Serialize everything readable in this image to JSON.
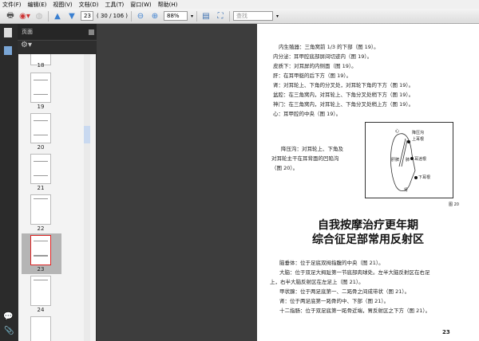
{
  "menu": [
    "文件(F)",
    "编辑(E)",
    "视图(V)",
    "文档(D)",
    "工具(T)",
    "窗口(W)",
    "帮助(H)"
  ],
  "toolbar": {
    "page_value": "23",
    "page_count": "( 30 / 106 )",
    "zoom": "88%",
    "search_placeholder": "查找"
  },
  "panel": {
    "title": "页面"
  },
  "thumbnails": [
    "18",
    "19",
    "20",
    "21",
    "22",
    "23",
    "24"
  ],
  "selected_page": "23",
  "document": {
    "lines": [
      "内生殖器：三角窝前 1/3 的下部（图 19）。",
      "内分泌：耳甲腔底部屏间切迹内（图 19）。",
      "皮质下：对耳屏的内侧面（图 19）。",
      "肝：在耳甲艇的后下方（图 19）。",
      "肾：对耳轮上、下角的分叉处，对耳轮下角的下方（图 19）。",
      "盆腔：在三角窝内，对耳轮上、下角分叉处稍下方（图 19）。",
      "神门：在三角窝内，对耳轮上、下角分叉处稍上方（图 19）。",
      "心：耳甲腔的中央（图 19）。"
    ],
    "groove_lines": [
      "降压沟：对耳轮上、下角及",
      "对耳轮主干在耳背面的凹陷沟",
      "（图 20）。"
    ],
    "figure_labels": [
      "心",
      "降压沟",
      "上耳根",
      "肝脾",
      "肺",
      "耳迷根",
      "下耳根",
      "肾"
    ],
    "figure_caption": "图 20",
    "heading": [
      "自我按摩治疗更年期",
      "综合征足部常用反射区"
    ],
    "body": [
      "脑垂体：位于足底双拇指腹的中央（图 21）。",
      "大脑：位于双足大拇趾第一节底部肉球处。左半大脑反射区在右足",
      "上，右半大脑反射区在左足上（图 21）。",
      "甲状腺：位于两足底第一、二跖骨之间成带状（图 21）。",
      "肾：位于两足底第一跖骨的中、下部（图 21）。",
      "十二指肠：位于双足底第一跖骨近端，胃反射区之下方（图 21）。"
    ],
    "page_number": "23"
  }
}
